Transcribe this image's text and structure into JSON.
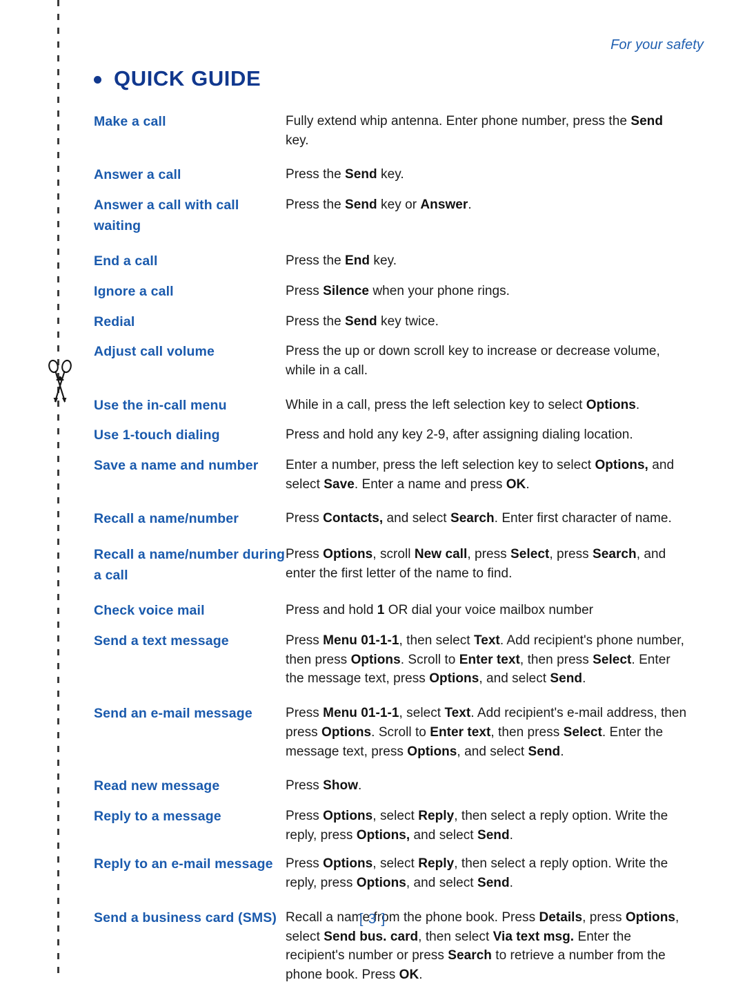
{
  "running_head": "For your safety",
  "heading": {
    "bullet_icon": "bullet-dot-icon",
    "text": "QUICK GUIDE"
  },
  "cut_line": {
    "scissors_icon": "scissors-icon"
  },
  "folio": "[ 3 ]",
  "colors": {
    "heading_blue": "#11388e",
    "label_blue": "#1a5aad",
    "running_head_blue": "#1f5fb0",
    "body_text": "#1b1b1b",
    "cut_line": "#3b3b3b"
  },
  "guide": {
    "rows": [
      {
        "term": "Make a call",
        "desc_html": "Fully extend whip antenna. Enter phone number, press the <b>Send</b> key."
      },
      {
        "term": "Answer a call",
        "desc_html": "Press the <b>Send</b> key."
      },
      {
        "term": "Answer a call with call waiting",
        "desc_html": "Press the <b>Send</b> key or <b>Answer</b>."
      },
      {
        "term": "End a call",
        "desc_html": "Press the <b>End</b> key."
      },
      {
        "term": "Ignore a call",
        "desc_html": "Press <b>Silence</b> when your phone rings."
      },
      {
        "term": "Redial",
        "desc_html": "Press the <b>Send</b> key twice."
      },
      {
        "term": "Adjust call volume",
        "desc_html": "Press the up or down scroll key to increase or decrease volume, while in a call."
      },
      {
        "term": "Use the in-call menu",
        "desc_html": "While in a call, press the left selection key to select <b>Options</b>."
      },
      {
        "term": "Use 1-touch dialing",
        "desc_html": "Press and hold any key 2-9, after assigning dialing location."
      },
      {
        "term": "Save a name and number",
        "desc_html": "Enter a number, press the left selection key to select <b>Options,</b> and select <b>Save</b>. Enter a name and press <b>OK</b>."
      },
      {
        "term": "Recall a name/number",
        "desc_html": "Press <b>Contacts,</b> and select <b>Search</b>. Enter first character of name."
      },
      {
        "term": "Recall a name/number during a call",
        "desc_html": "Press <b>Options</b>, scroll <b>New call</b>, press <b>Select</b>, press <b>Search</b>, and enter the first letter of the name to find."
      },
      {
        "term": "Check voice mail",
        "desc_html": "Press and hold <b>1</b> OR dial your voice mailbox number"
      },
      {
        "term": "Send a text message",
        "desc_html": "Press <b>Menu 01-1-1</b>, then select <b>Text</b>. Add recipient's phone number, then press <b>Options</b>. Scroll to <b>Enter text</b>, then press <b>Select</b>. Enter the message text, press <b>Options</b>, and select <b>Send</b>."
      },
      {
        "term": "Send an e-mail message",
        "desc_html": "Press <b>Menu 01-1-1</b>, select <b>Text</b>. Add recipient's e-mail address, then press <b>Options</b>. Scroll to <b>Enter text</b>, then press <b>Select</b>. Enter the message text, press <b>Options</b>, and select <b>Send</b>."
      },
      {
        "term": "Read new message",
        "desc_html": "Press <b>Show</b>."
      },
      {
        "term": "Reply to a message",
        "desc_html": "Press <b>Options</b>, select <b>Reply</b>, then select a reply option. Write the reply, press <b>Options,</b> and select <b>Send</b>."
      },
      {
        "term": "Reply to an e-mail message",
        "desc_html": "Press <b>Options</b>, select <b>Reply</b>, then select a reply option. Write the reply, press <b>Options</b>, and select <b>Send</b>."
      },
      {
        "term": "Send a business card (SMS)",
        "desc_html": "Recall a name from the phone book. Press <b>Details</b>, press <b>Options</b>, select <b>Send bus. card</b>, then select <b>Via text msg.</b> Enter the recipient's number or press <b>Search</b> to retrieve a number from the phone book. Press <b>OK</b>."
      }
    ]
  }
}
